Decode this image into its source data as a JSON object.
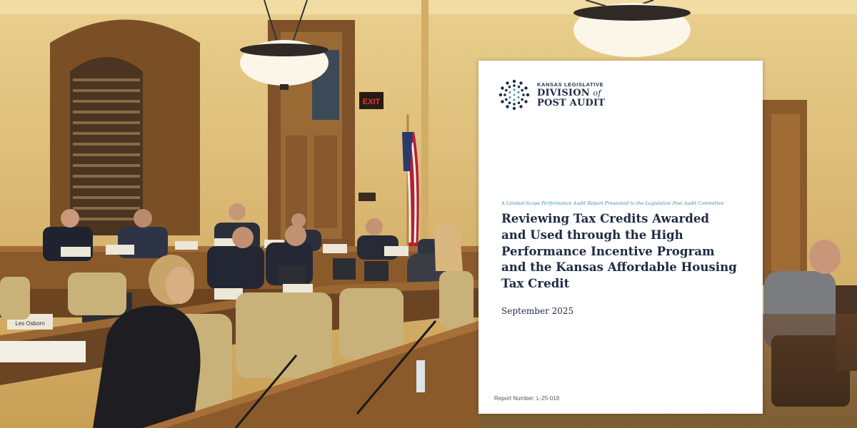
{
  "scene": {
    "exit_sign": "EXIT",
    "nameplates": [
      {
        "id": "left-front",
        "text": "Les Osborn"
      }
    ]
  },
  "report": {
    "logo_line1": "KANSAS LEGISLATIVE",
    "logo_line2_a": "DIVISION",
    "logo_line2_b": "of",
    "logo_line3": "POST AUDIT",
    "supertitle": "A Limited-Scope Performance Audit Report Presented to the Legislative Post Audit Committee",
    "title_lines": [
      "Reviewing Tax Credits Awarded",
      "and Used through the High",
      "Performance Incentive Program",
      "and the Kansas Affordable Housing",
      "Tax Credit"
    ],
    "date": "September 2025",
    "report_number": "Report Number: L-25-018"
  },
  "colors": {
    "wall": "#d9b870",
    "wood": "#8a5a2b",
    "report_text": "#1f2a44",
    "accent": "#3c8fa6"
  }
}
